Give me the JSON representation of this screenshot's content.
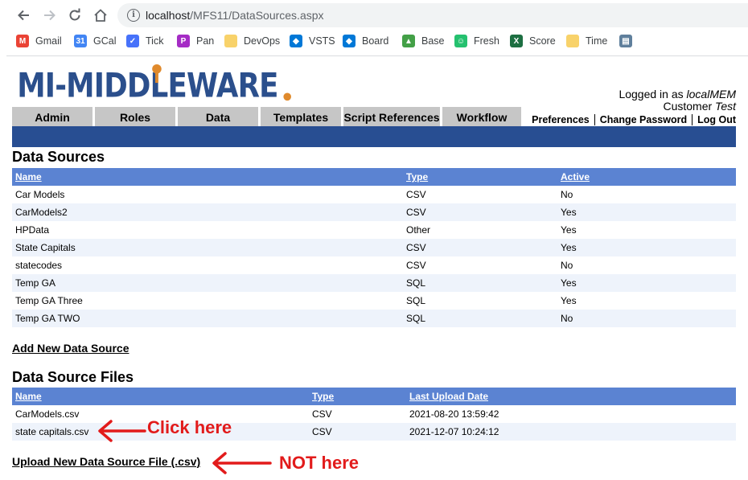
{
  "browser": {
    "url_host": "localhost",
    "url_path": "/MFS11/DataSources.aspx",
    "bookmarks": [
      {
        "label": "Gmail",
        "icon": "gmail-icon",
        "color": "#ea4335",
        "glyph": "M"
      },
      {
        "label": "GCal",
        "icon": "gcal-icon",
        "color": "#4285f4",
        "glyph": "31"
      },
      {
        "label": "Tick",
        "icon": "tick-icon",
        "color": "#4772fa",
        "glyph": "✓"
      },
      {
        "label": "Pan",
        "icon": "pan-icon",
        "color": "#a52cc5",
        "glyph": "P"
      },
      {
        "label": "DevOps",
        "icon": "folder-icon",
        "color": "#f8d26a",
        "glyph": ""
      },
      {
        "label": "VSTS",
        "icon": "vsts-icon",
        "color": "#0078d7",
        "glyph": "◆"
      },
      {
        "label": "Board",
        "icon": "board-icon",
        "color": "#0078d7",
        "glyph": "◆"
      },
      {
        "label": "Base",
        "icon": "base-icon",
        "color": "#43a047",
        "glyph": "▲"
      },
      {
        "label": "Fresh",
        "icon": "fresh-icon",
        "color": "#25c16f",
        "glyph": "☺"
      },
      {
        "label": "Score",
        "icon": "excel-icon",
        "color": "#1d6f42",
        "glyph": "X"
      },
      {
        "label": "Time",
        "icon": "folder-icon",
        "color": "#f8d26a",
        "glyph": ""
      },
      {
        "label": "",
        "icon": "app-icon",
        "color": "#5f7f9c",
        "glyph": "▤"
      }
    ]
  },
  "header": {
    "logo_text": "MI-MIDDLEWARE",
    "logged_in_prefix": "Logged in as ",
    "username": "localMEM",
    "customer_prefix": "Customer ",
    "customer": "Test",
    "links": [
      "Preferences",
      "Change Password",
      "Log Out"
    ],
    "tabs": [
      "Admin",
      "Roles",
      "Data",
      "Templates",
      "Script References",
      "Workflow"
    ]
  },
  "data_sources": {
    "title": "Data Sources",
    "columns": [
      "Name",
      "Type",
      "Active"
    ],
    "rows": [
      [
        "Car Models",
        "CSV",
        "No"
      ],
      [
        "CarModels2",
        "CSV",
        "Yes"
      ],
      [
        "HPData",
        "Other",
        "Yes"
      ],
      [
        "State Capitals",
        "CSV",
        "Yes"
      ],
      [
        "statecodes",
        "CSV",
        "No"
      ],
      [
        "Temp GA",
        "SQL",
        "Yes"
      ],
      [
        "Temp GA Three",
        "SQL",
        "Yes"
      ],
      [
        "Temp GA TWO",
        "SQL",
        "No"
      ]
    ],
    "add_link": "Add New Data Source"
  },
  "data_source_files": {
    "title": "Data Source Files",
    "columns": [
      "Name",
      "Type",
      "Last Upload Date"
    ],
    "rows": [
      [
        "CarModels.csv",
        "CSV",
        "2021-08-20 13:59:42"
      ],
      [
        "state capitals.csv",
        "CSV",
        "2021-12-07 10:24:12"
      ]
    ],
    "upload_link": "Upload New Data Source File (.csv)"
  },
  "annotations": {
    "click_here": "Click here",
    "not_here": "NOT here",
    "color": "#e21b1b"
  }
}
